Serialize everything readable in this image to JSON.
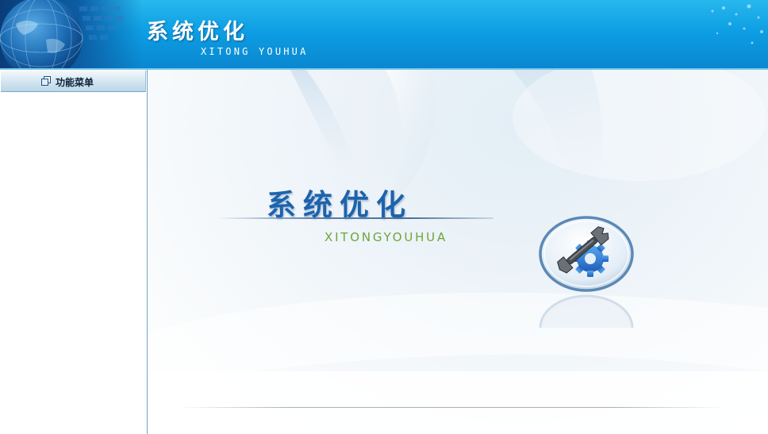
{
  "header": {
    "title": "系统优化",
    "subtitle": "XITONG YOUHUA",
    "icons": {
      "globe": "globe-icon"
    }
  },
  "sidebar": {
    "title": "功能菜单",
    "title_icon": "windows-icon"
  },
  "main": {
    "logo_title": "系统优化",
    "logo_subtitle": "XITONGYOUHUA",
    "badge_icon": "wrench-gear-icon"
  },
  "colors": {
    "header_blue": "#0d9ee3",
    "logo_title": "#1d63ab",
    "logo_subtitle": "#6fa53a"
  }
}
